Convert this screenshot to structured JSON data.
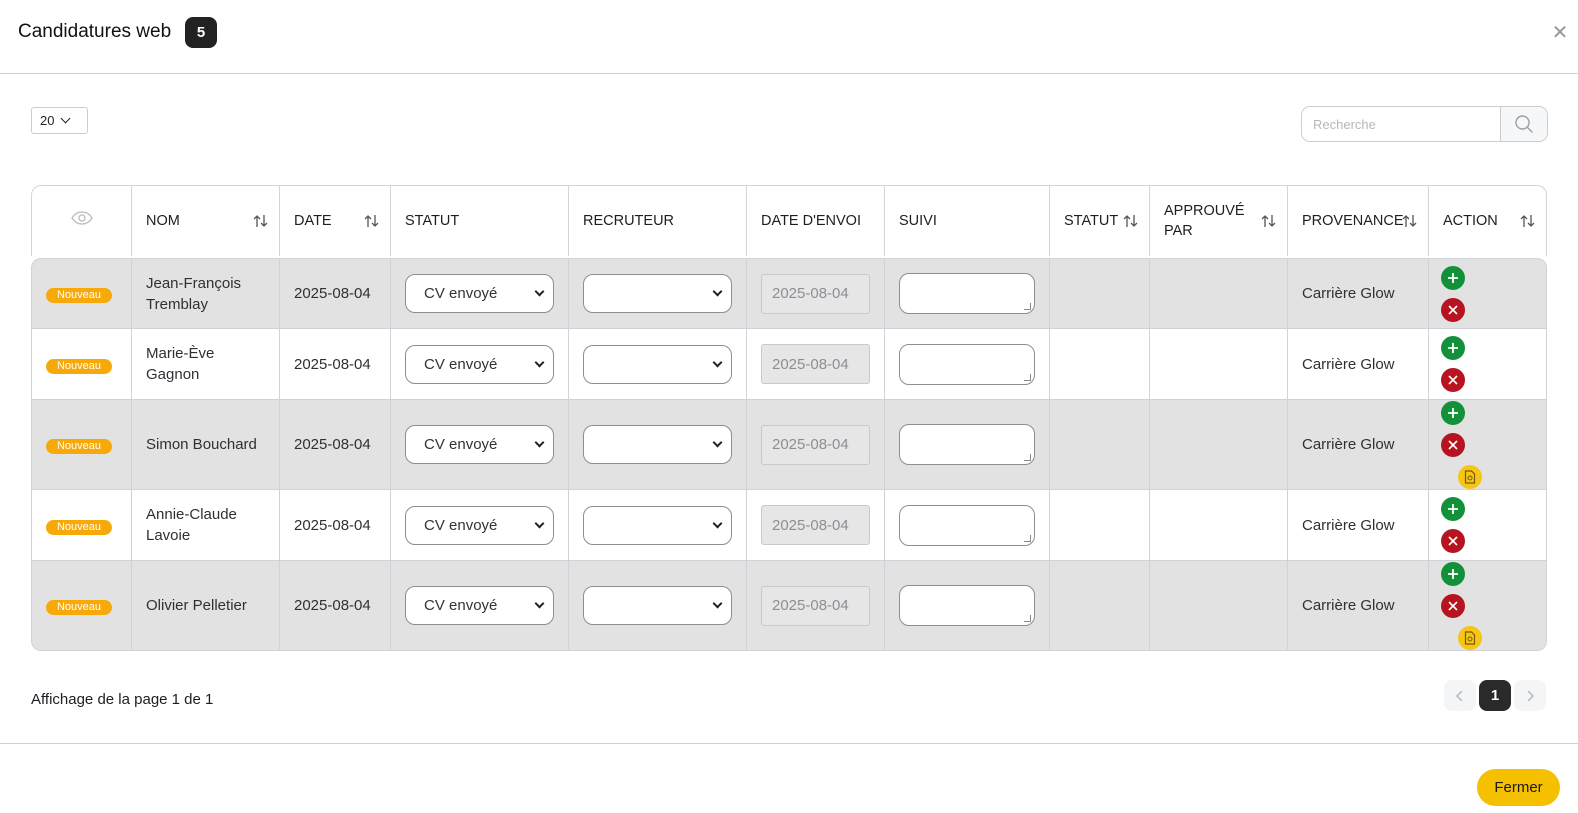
{
  "header": {
    "title": "Candidatures web",
    "count": "5",
    "close_icon": "close-icon"
  },
  "toolbar": {
    "page_length": "20",
    "search_placeholder": "Recherche"
  },
  "table": {
    "columns": [
      {
        "label": "",
        "icon": "eye-icon",
        "sortable": false
      },
      {
        "label": "NOM",
        "sortable": true
      },
      {
        "label": "DATE",
        "sortable": true
      },
      {
        "label": "STATUT",
        "sortable": false
      },
      {
        "label": "RECRUTEUR",
        "sortable": false
      },
      {
        "label": "DATE D'ENVOI",
        "sortable": false
      },
      {
        "label": "SUIVI",
        "sortable": false
      },
      {
        "label": "STATUT",
        "sortable": true
      },
      {
        "label": "APPROUVÉ PAR",
        "sortable": true
      },
      {
        "label": "PROVENANCE",
        "sortable": true
      },
      {
        "label": "ACTION",
        "sortable": true
      }
    ],
    "rows": [
      {
        "badge": "Nouveau",
        "nom": "Jean-François Tremblay",
        "date": "2025-08-04",
        "statut": "CV envoyé",
        "recruteur": "",
        "date_envoi": "2025-08-04",
        "suivi": "",
        "statut2": "",
        "approuve": "",
        "provenance": "Carrière Glow",
        "has_doc": false
      },
      {
        "badge": "Nouveau",
        "nom": "Marie-Ève Gagnon",
        "date": "2025-08-04",
        "statut": "CV envoyé",
        "recruteur": "",
        "date_envoi": "2025-08-04",
        "suivi": "",
        "statut2": "",
        "approuve": "",
        "provenance": "Carrière Glow",
        "has_doc": false
      },
      {
        "badge": "Nouveau",
        "nom": "Simon Bouchard",
        "date": "2025-08-04",
        "statut": "CV envoyé",
        "recruteur": "",
        "date_envoi": "2025-08-04",
        "suivi": "",
        "statut2": "",
        "approuve": "",
        "provenance": "Carrière Glow",
        "has_doc": true
      },
      {
        "badge": "Nouveau",
        "nom": "Annie-Claude Lavoie",
        "date": "2025-08-04",
        "statut": "CV envoyé",
        "recruteur": "",
        "date_envoi": "2025-08-04",
        "suivi": "",
        "statut2": "",
        "approuve": "",
        "provenance": "Carrière Glow",
        "has_doc": false
      },
      {
        "badge": "Nouveau",
        "nom": "Olivier Pelletier",
        "date": "2025-08-04",
        "statut": "CV envoyé",
        "recruteur": "",
        "date_envoi": "2025-08-04",
        "suivi": "",
        "statut2": "",
        "approuve": "",
        "provenance": "Carrière Glow",
        "has_doc": true
      }
    ]
  },
  "pagination": {
    "info": "Affichage de la page 1 de 1",
    "current_page": "1"
  },
  "footer": {
    "close_label": "Fermer"
  },
  "colors": {
    "badge": "#f7a90a",
    "add": "#12913a",
    "delete": "#b51420",
    "doc": "#f5c518",
    "primary": "#f5c000"
  }
}
